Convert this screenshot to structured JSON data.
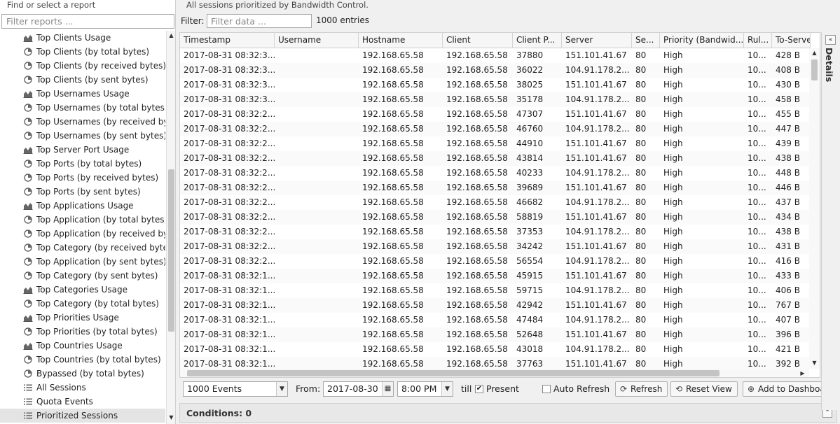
{
  "left_panel": {
    "title": "Find or select a report",
    "filter_placeholder": "Filter reports ...",
    "items": [
      {
        "label": "Top Clients Usage",
        "icon": "area-chart-icon"
      },
      {
        "label": "Top Clients (by total bytes)",
        "icon": "pie-chart-icon"
      },
      {
        "label": "Top Clients (by received bytes)",
        "icon": "pie-chart-icon"
      },
      {
        "label": "Top Clients (by sent bytes)",
        "icon": "pie-chart-icon"
      },
      {
        "label": "Top Usernames Usage",
        "icon": "area-chart-icon"
      },
      {
        "label": "Top Usernames (by total bytes)",
        "icon": "pie-chart-icon"
      },
      {
        "label": "Top Usernames (by received bytes)",
        "icon": "pie-chart-icon"
      },
      {
        "label": "Top Usernames (by sent bytes)",
        "icon": "pie-chart-icon"
      },
      {
        "label": "Top Server Port Usage",
        "icon": "area-chart-icon"
      },
      {
        "label": "Top Ports (by total bytes)",
        "icon": "pie-chart-icon"
      },
      {
        "label": "Top Ports (by received bytes)",
        "icon": "pie-chart-icon"
      },
      {
        "label": "Top Ports (by sent bytes)",
        "icon": "pie-chart-icon"
      },
      {
        "label": "Top Applications Usage",
        "icon": "area-chart-icon"
      },
      {
        "label": "Top Application (by total bytes)",
        "icon": "pie-chart-icon"
      },
      {
        "label": "Top Application (by received bytes)",
        "icon": "pie-chart-icon"
      },
      {
        "label": "Top Category (by received bytes)",
        "icon": "pie-chart-icon"
      },
      {
        "label": "Top Application (by sent bytes)",
        "icon": "pie-chart-icon"
      },
      {
        "label": "Top Category (by sent bytes)",
        "icon": "pie-chart-icon"
      },
      {
        "label": "Top Categories Usage",
        "icon": "area-chart-icon"
      },
      {
        "label": "Top Category (by total bytes)",
        "icon": "pie-chart-icon"
      },
      {
        "label": "Top Priorities Usage",
        "icon": "area-chart-icon"
      },
      {
        "label": "Top Priorities (by total bytes)",
        "icon": "pie-chart-icon"
      },
      {
        "label": "Top Countries Usage",
        "icon": "area-chart-icon"
      },
      {
        "label": "Top Countries (by total bytes)",
        "icon": "pie-chart-icon"
      },
      {
        "label": "Bypassed (by total bytes)",
        "icon": "pie-chart-icon"
      },
      {
        "label": "All Sessions",
        "icon": "list-icon"
      },
      {
        "label": "Quota Events",
        "icon": "list-icon"
      },
      {
        "label": "Prioritized Sessions",
        "icon": "list-icon",
        "selected": true
      }
    ]
  },
  "main": {
    "description": "All sessions prioritized by Bandwidth Control.",
    "filter_label": "Filter:",
    "filter_placeholder": "Filter data ...",
    "entries": "1000 entries"
  },
  "grid": {
    "columns": [
      "Timestamp",
      "Username",
      "Hostname",
      "Client",
      "Client P...",
      "Server",
      "Se...",
      "Priority (Bandwid...",
      "Rul...",
      "To-Server"
    ],
    "rows": [
      [
        "2017-08-31 08:32:3...",
        "",
        "192.168.65.58",
        "192.168.65.58",
        "37880",
        "151.101.41.67",
        "80",
        "High",
        "10...",
        "428 B"
      ],
      [
        "2017-08-31 08:32:3...",
        "",
        "192.168.65.58",
        "192.168.65.58",
        "36022",
        "104.91.178.2...",
        "80",
        "High",
        "10...",
        "408 B"
      ],
      [
        "2017-08-31 08:32:3...",
        "",
        "192.168.65.58",
        "192.168.65.58",
        "38025",
        "151.101.41.67",
        "80",
        "High",
        "10...",
        "430 B"
      ],
      [
        "2017-08-31 08:32:3...",
        "",
        "192.168.65.58",
        "192.168.65.58",
        "35178",
        "104.91.178.2...",
        "80",
        "High",
        "10...",
        "458 B"
      ],
      [
        "2017-08-31 08:32:2...",
        "",
        "192.168.65.58",
        "192.168.65.58",
        "47307",
        "151.101.41.67",
        "80",
        "High",
        "10...",
        "455 B"
      ],
      [
        "2017-08-31 08:32:2...",
        "",
        "192.168.65.58",
        "192.168.65.58",
        "46760",
        "104.91.178.2...",
        "80",
        "High",
        "10...",
        "447 B"
      ],
      [
        "2017-08-31 08:32:2...",
        "",
        "192.168.65.58",
        "192.168.65.58",
        "44910",
        "151.101.41.67",
        "80",
        "High",
        "10...",
        "439 B"
      ],
      [
        "2017-08-31 08:32:2...",
        "",
        "192.168.65.58",
        "192.168.65.58",
        "43814",
        "151.101.41.67",
        "80",
        "High",
        "10...",
        "438 B"
      ],
      [
        "2017-08-31 08:32:2...",
        "",
        "192.168.65.58",
        "192.168.65.58",
        "40233",
        "104.91.178.2...",
        "80",
        "High",
        "10...",
        "448 B"
      ],
      [
        "2017-08-31 08:32:2...",
        "",
        "192.168.65.58",
        "192.168.65.58",
        "39689",
        "151.101.41.67",
        "80",
        "High",
        "10...",
        "446 B"
      ],
      [
        "2017-08-31 08:32:2...",
        "",
        "192.168.65.58",
        "192.168.65.58",
        "46682",
        "104.91.178.2...",
        "80",
        "High",
        "10...",
        "437 B"
      ],
      [
        "2017-08-31 08:32:2...",
        "",
        "192.168.65.58",
        "192.168.65.58",
        "58819",
        "151.101.41.67",
        "80",
        "High",
        "10...",
        "434 B"
      ],
      [
        "2017-08-31 08:32:2...",
        "",
        "192.168.65.58",
        "192.168.65.58",
        "37353",
        "104.91.178.2...",
        "80",
        "High",
        "10...",
        "438 B"
      ],
      [
        "2017-08-31 08:32:2...",
        "",
        "192.168.65.58",
        "192.168.65.58",
        "34242",
        "151.101.41.67",
        "80",
        "High",
        "10...",
        "431 B"
      ],
      [
        "2017-08-31 08:32:2...",
        "",
        "192.168.65.58",
        "192.168.65.58",
        "56554",
        "104.91.178.2...",
        "80",
        "High",
        "10...",
        "416 B"
      ],
      [
        "2017-08-31 08:32:1...",
        "",
        "192.168.65.58",
        "192.168.65.58",
        "45915",
        "151.101.41.67",
        "80",
        "High",
        "10...",
        "433 B"
      ],
      [
        "2017-08-31 08:32:1...",
        "",
        "192.168.65.58",
        "192.168.65.58",
        "59715",
        "104.91.178.2...",
        "80",
        "High",
        "10...",
        "406 B"
      ],
      [
        "2017-08-31 08:32:1...",
        "",
        "192.168.65.58",
        "192.168.65.58",
        "42942",
        "151.101.41.67",
        "80",
        "High",
        "10...",
        "767 B"
      ],
      [
        "2017-08-31 08:32:1...",
        "",
        "192.168.65.58",
        "192.168.65.58",
        "47484",
        "104.91.178.2...",
        "80",
        "High",
        "10...",
        "407 B"
      ],
      [
        "2017-08-31 08:32:1...",
        "",
        "192.168.65.58",
        "192.168.65.58",
        "52648",
        "151.101.41.67",
        "80",
        "High",
        "10...",
        "396 B"
      ],
      [
        "2017-08-31 08:32:1...",
        "",
        "192.168.65.58",
        "192.168.65.58",
        "43018",
        "104.91.178.2...",
        "80",
        "High",
        "10...",
        "421 B"
      ],
      [
        "2017-08-31 08:32:1...",
        "",
        "192.168.65.58",
        "192.168.65.58",
        "37763",
        "151.101.41.67",
        "80",
        "High",
        "10...",
        "392 B"
      ]
    ]
  },
  "toolbar": {
    "events_select": "1000 Events",
    "from_label": "From:",
    "from_date": "2017-08-30",
    "from_time": "8:00 PM",
    "till_label": "till",
    "present_label": "Present",
    "present_checked": true,
    "auto_refresh_label": "Auto Refresh",
    "refresh_label": "Refresh",
    "reset_view_label": "Reset View",
    "add_dashboard_label": "Add to Dashboard"
  },
  "conditions": {
    "label": "Conditions: 0"
  },
  "details": {
    "label": "Details"
  }
}
